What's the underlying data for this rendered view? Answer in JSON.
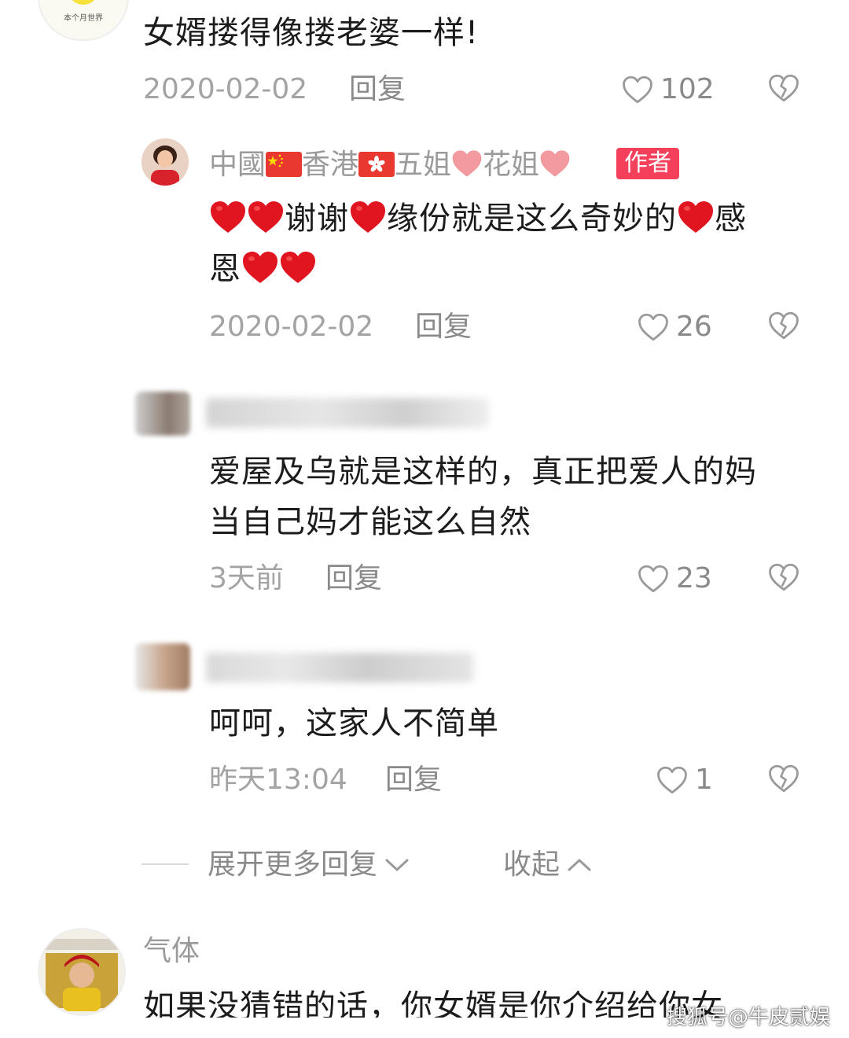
{
  "comments": [
    {
      "text": "女婿搂得像搂老婆一样!",
      "date": "2020-02-02",
      "reply_label": "回复",
      "likes": "102",
      "avatar_caption": "本个月世界"
    },
    {
      "author": "中國香港五姐花姐",
      "author_parts": [
        "中國",
        "香港",
        "五姐",
        "花姐"
      ],
      "badge": "作者",
      "text_parts": [
        "谢谢",
        "缘份就是这么奇妙的",
        "感",
        "恩"
      ],
      "date": "2020-02-02",
      "reply_label": "回复",
      "likes": "26"
    },
    {
      "line1": "爱屋及乌就是这样的，真正把爱人的妈",
      "line2": "当自己妈才能这么自然",
      "date": "3天前",
      "reply_label": "回复",
      "likes": "23"
    },
    {
      "text": "呵呵，这家人不简单",
      "date": "昨天13:04",
      "reply_label": "回复",
      "likes": "1"
    },
    {
      "author": "气体",
      "text": "如果没猜错的话，你女婿是你介绍给你女"
    }
  ],
  "thread": {
    "expand_label": "展开更多回复",
    "collapse_label": "收起"
  },
  "watermark": "搜狐号@牛皮贰娱",
  "colors": {
    "badge": "#f4405b",
    "heart_red": "#e0151f",
    "meta_gray": "#a3a3a3"
  },
  "icons": [
    "heart-outline-icon",
    "broken-heart-icon",
    "red-heart-emoji",
    "china-flag-icon",
    "hongkong-flag-icon",
    "chevron-down-icon",
    "chevron-up-icon"
  ]
}
